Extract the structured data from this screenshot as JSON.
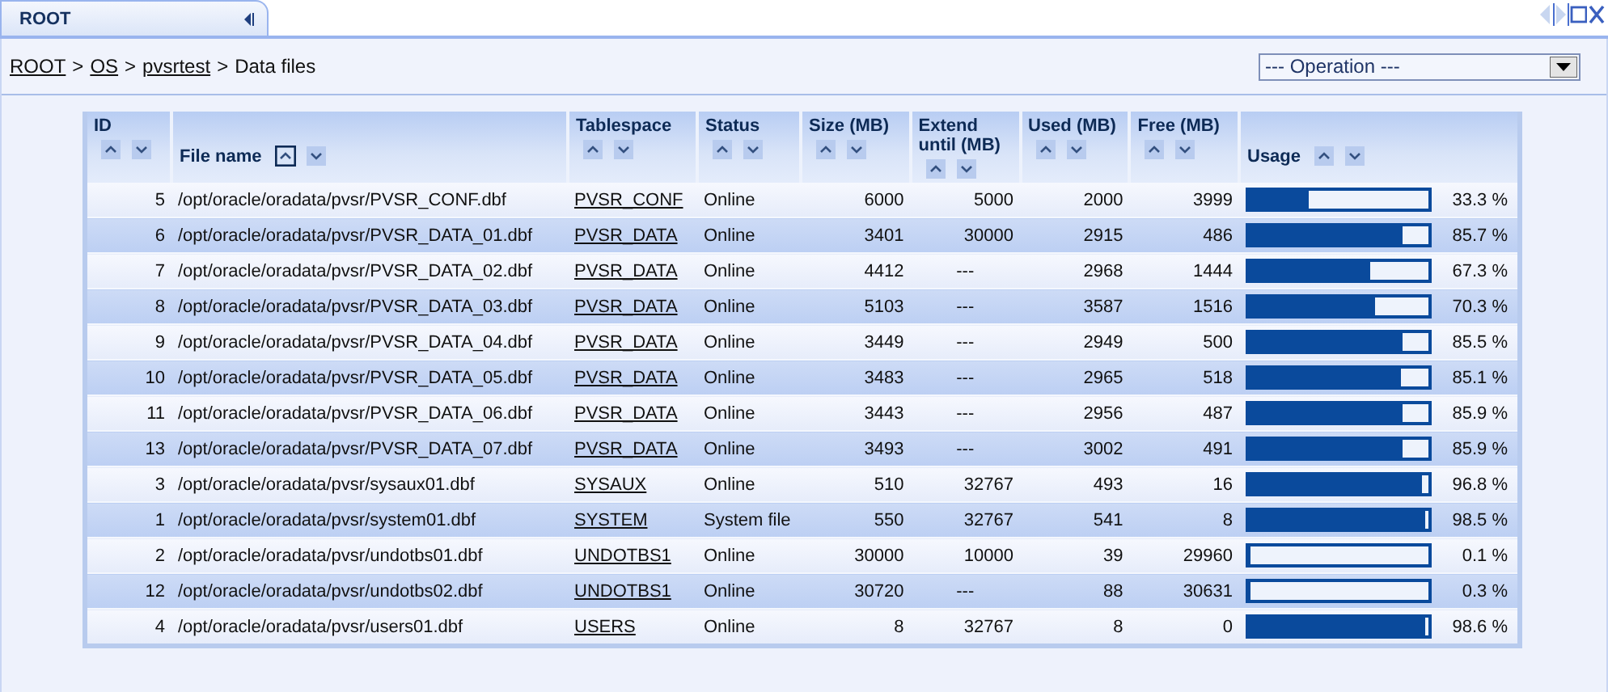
{
  "tab": {
    "label": "ROOT"
  },
  "breadcrumb": [
    {
      "label": "ROOT",
      "kind": "link"
    },
    {
      "label": ">",
      "kind": "separator"
    },
    {
      "label": "OS",
      "kind": "link"
    },
    {
      "label": ">",
      "kind": "separator"
    },
    {
      "label": "pvsrtest",
      "kind": "link"
    },
    {
      "label": ">",
      "kind": "separator"
    },
    {
      "label": "Data files",
      "kind": "current"
    }
  ],
  "operation_select": {
    "value": "--- Operation ---"
  },
  "table": {
    "columns": [
      {
        "label": "ID",
        "sorted_ascending": false
      },
      {
        "label": "File name",
        "sorted_ascending": true
      },
      {
        "label": "Tablespace",
        "sorted_ascending": false
      },
      {
        "label": "Status",
        "sorted_ascending": false
      },
      {
        "label": "Size (MB)",
        "sorted_ascending": false
      },
      {
        "label": "Extend until (MB)",
        "sorted_ascending": false
      },
      {
        "label": "Used (MB)",
        "sorted_ascending": false
      },
      {
        "label": "Free (MB)",
        "sorted_ascending": false
      },
      {
        "label": "Usage",
        "sorted_ascending": false
      }
    ],
    "rows": [
      {
        "id": "5",
        "file": "/opt/oracle/oradata/pvsr/PVSR_CONF.dbf",
        "tablespace": "PVSR_CONF",
        "status": "Online",
        "size": "6000",
        "extend": "5000",
        "used": "2000",
        "free": "3999",
        "level": 0.333,
        "usage": "33.3 %"
      },
      {
        "id": "6",
        "file": "/opt/oracle/oradata/pvsr/PVSR_DATA_01.dbf",
        "tablespace": "PVSR_DATA",
        "status": "Online",
        "size": "3401",
        "extend": "30000",
        "used": "2915",
        "free": "486",
        "level": 0.857,
        "usage": "85.7 %"
      },
      {
        "id": "7",
        "file": "/opt/oracle/oradata/pvsr/PVSR_DATA_02.dbf",
        "tablespace": "PVSR_DATA",
        "status": "Online",
        "size": "4412",
        "extend": "---",
        "used": "2968",
        "free": "1444",
        "level": 0.673,
        "usage": "67.3 %"
      },
      {
        "id": "8",
        "file": "/opt/oracle/oradata/pvsr/PVSR_DATA_03.dbf",
        "tablespace": "PVSR_DATA",
        "status": "Online",
        "size": "5103",
        "extend": "---",
        "used": "3587",
        "free": "1516",
        "level": 0.703,
        "usage": "70.3 %"
      },
      {
        "id": "9",
        "file": "/opt/oracle/oradata/pvsr/PVSR_DATA_04.dbf",
        "tablespace": "PVSR_DATA",
        "status": "Online",
        "size": "3449",
        "extend": "---",
        "used": "2949",
        "free": "500",
        "level": 0.855,
        "usage": "85.5 %"
      },
      {
        "id": "10",
        "file": "/opt/oracle/oradata/pvsr/PVSR_DATA_05.dbf",
        "tablespace": "PVSR_DATA",
        "status": "Online",
        "size": "3483",
        "extend": "---",
        "used": "2965",
        "free": "518",
        "level": 0.851,
        "usage": "85.1 %"
      },
      {
        "id": "11",
        "file": "/opt/oracle/oradata/pvsr/PVSR_DATA_06.dbf",
        "tablespace": "PVSR_DATA",
        "status": "Online",
        "size": "3443",
        "extend": "---",
        "used": "2956",
        "free": "487",
        "level": 0.859,
        "usage": "85.9 %"
      },
      {
        "id": "13",
        "file": "/opt/oracle/oradata/pvsr/PVSR_DATA_07.dbf",
        "tablespace": "PVSR_DATA",
        "status": "Online",
        "size": "3493",
        "extend": "---",
        "used": "3002",
        "free": "491",
        "level": 0.859,
        "usage": "85.9 %"
      },
      {
        "id": "3",
        "file": "/opt/oracle/oradata/pvsr/sysaux01.dbf",
        "tablespace": "SYSAUX",
        "status": "Online",
        "size": "510",
        "extend": "32767",
        "used": "493",
        "free": "16",
        "level": 0.968,
        "usage": "96.8 %"
      },
      {
        "id": "1",
        "file": "/opt/oracle/oradata/pvsr/system01.dbf",
        "tablespace": "SYSTEM",
        "status": "System file",
        "size": "550",
        "extend": "32767",
        "used": "541",
        "free": "8",
        "level": 0.985,
        "usage": "98.5 %"
      },
      {
        "id": "2",
        "file": "/opt/oracle/oradata/pvsr/undotbs01.dbf",
        "tablespace": "UNDOTBS1",
        "status": "Online",
        "size": "30000",
        "extend": "10000",
        "used": "39",
        "free": "29960",
        "level": 0.001,
        "usage": "0.1 %"
      },
      {
        "id": "12",
        "file": "/opt/oracle/oradata/pvsr/undotbs02.dbf",
        "tablespace": "UNDOTBS1",
        "status": "Online",
        "size": "30720",
        "extend": "---",
        "used": "88",
        "free": "30631",
        "level": 0.003,
        "usage": "0.3 %"
      },
      {
        "id": "4",
        "file": "/opt/oracle/oradata/pvsr/users01.dbf",
        "tablespace": "USERS",
        "status": "Online",
        "size": "8",
        "extend": "32767",
        "used": "8",
        "free": "0",
        "level": 0.986,
        "usage": "98.6 %"
      }
    ]
  }
}
